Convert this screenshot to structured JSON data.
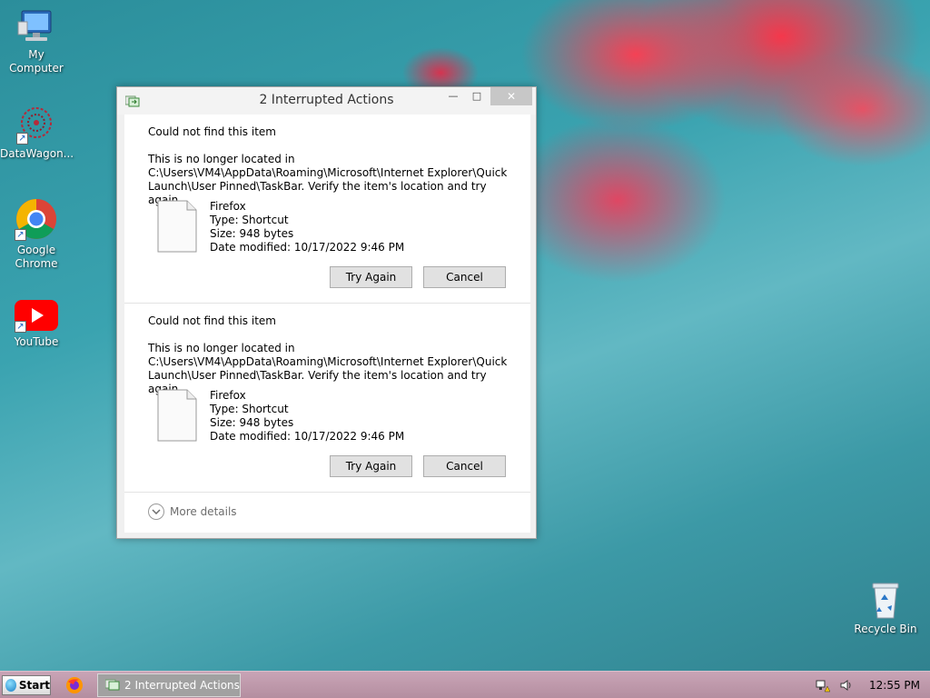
{
  "desktop": {
    "icons": [
      {
        "label": "My Computer"
      },
      {
        "label": "DataWagon..."
      },
      {
        "label": "Google Chrome"
      },
      {
        "label": "YouTube"
      },
      {
        "label": "Recycle Bin"
      }
    ]
  },
  "dialog": {
    "title": "2 Interrupted Actions",
    "items": [
      {
        "heading": "Could not find this item",
        "description": "This is no longer located in C:\\Users\\VM4\\AppData\\Roaming\\Microsoft\\Internet Explorer\\Quick Launch\\User Pinned\\TaskBar. Verify the item's location and try again.",
        "file_name": "Firefox",
        "file_type": "Type: Shortcut",
        "file_size": "Size: 948 bytes",
        "file_date": "Date modified: 10/17/2022 9:46 PM",
        "try_again_label": "Try Again",
        "cancel_label": "Cancel"
      },
      {
        "heading": "Could not find this item",
        "description": "This is no longer located in C:\\Users\\VM4\\AppData\\Roaming\\Microsoft\\Internet Explorer\\Quick Launch\\User Pinned\\TaskBar. Verify the item's location and try again.",
        "file_name": "Firefox",
        "file_type": "Type: Shortcut",
        "file_size": "Size: 948 bytes",
        "file_date": "Date modified: 10/17/2022 9:46 PM",
        "try_again_label": "Try Again",
        "cancel_label": "Cancel"
      }
    ],
    "more_details_label": "More details"
  },
  "taskbar": {
    "start_label": "Start",
    "task_label": "2 Interrupted Actions",
    "clock": "12:55 PM"
  },
  "colors": {
    "taskbar": "#b896a8",
    "button_face": "#e1e1e1",
    "close_button": "#c7c7c7"
  }
}
